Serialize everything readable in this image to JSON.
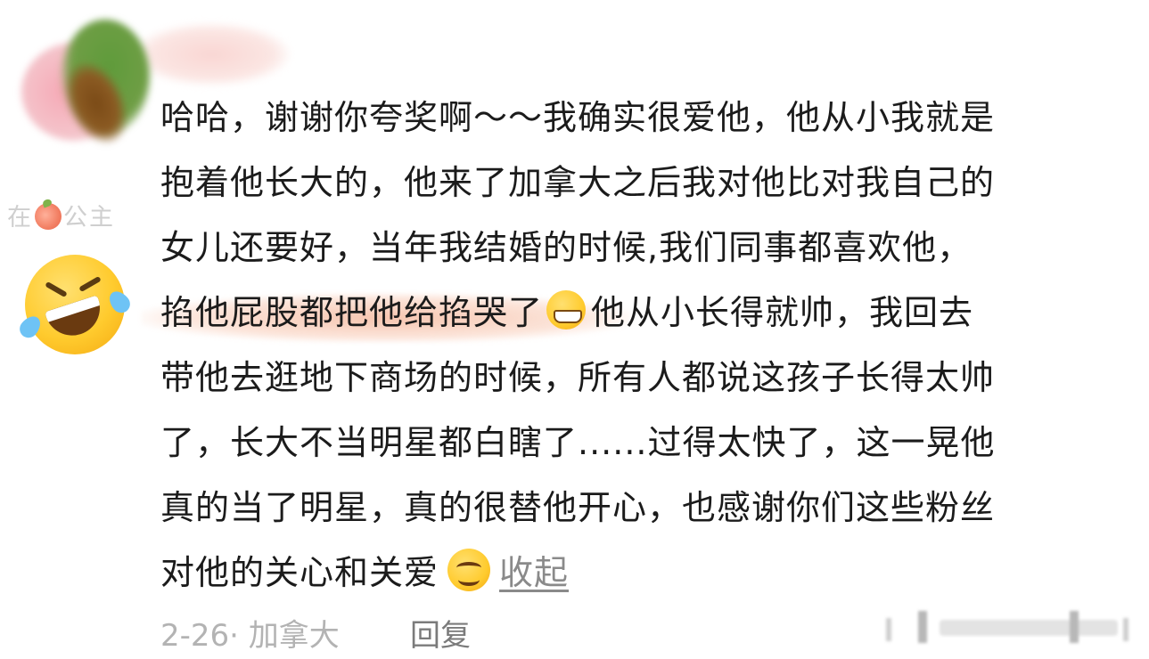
{
  "comment": {
    "username": {
      "part1": "在",
      "part2": "公主"
    },
    "lines": [
      "哈哈，谢谢你夸奖啊～～我确实很爱他，他从小我就是",
      "抱着他长大的，他来了加拿大之后我对他比对我自己的",
      "女儿还要好，当年我结婚的时候,我们同事都喜欢他，",
      "掐他屁股都把他给掐哭了",
      "他从小长得就帅，我回去",
      "带他去逛地下商场的时候，所有人都说这孩子长得太帅",
      "了，长大不当明星都白瞎了......过得太快了，这一晃他",
      "真的当了明星，真的很替他开心，也感谢你们这些粉丝",
      "对他的关心和关爱"
    ],
    "collapse_label": "收起",
    "meta": "2-26· 加拿大",
    "reply_label": "回复"
  },
  "icons": {
    "peach": "peach-emoji-icon",
    "rofl": "rolling-laughing-emoji-icon",
    "grin": "grinning-emoji-icon",
    "smile": "smiling-emoji-icon"
  },
  "colors": {
    "highlight": "#f0966e",
    "text": "#1b1b1b",
    "meta": "#b3b3b3"
  }
}
